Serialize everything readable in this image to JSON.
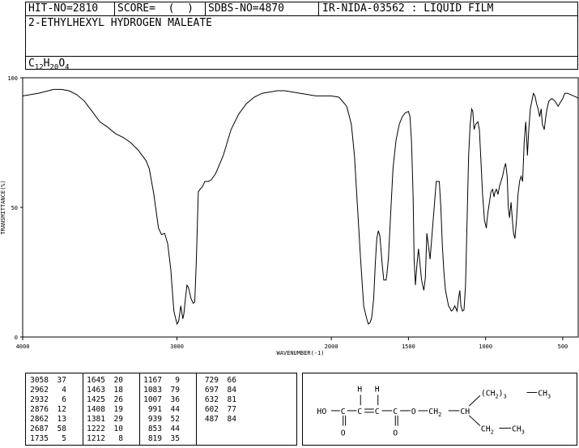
{
  "header": {
    "hit_no": "HIT-NO=2810",
    "score": "SCORE=  (  )",
    "sdbs_no": "SDBS-NO=4870",
    "method": "IR-NIDA-03562 : LIQUID FILM",
    "compound_name": "2-ETHYLHEXYL HYDROGEN MALEATE",
    "formula": {
      "c": "C",
      "c_n": "12",
      "h": "H",
      "h_n": "20",
      "o": "O",
      "o_n": "4"
    }
  },
  "chart_data": {
    "type": "line",
    "xlabel": "WAVENUMBER(-1)",
    "ylabel": "TRANSMITTANCE(%)",
    "xlim": [
      4000,
      400
    ],
    "ylim": [
      0,
      100
    ],
    "x_ticks": [
      4000,
      3000,
      2000,
      1500,
      1000,
      500
    ],
    "x_tick_labels": [
      "4000",
      "3000",
      "2000",
      "1500",
      "1000",
      "500"
    ],
    "y_ticks": [
      0,
      50,
      100
    ],
    "y_tick_labels": [
      "0",
      "50",
      "100"
    ],
    "series": [
      {
        "x": [
          4000,
          3900,
          3800,
          3750,
          3700,
          3650,
          3600,
          3550,
          3500,
          3450,
          3400,
          3350,
          3300,
          3250,
          3200,
          3180,
          3150,
          3120,
          3100,
          3080,
          3060,
          3040,
          3020,
          3000,
          2990,
          2975,
          2962,
          2955,
          2945,
          2935,
          2925,
          2910,
          2895,
          2885,
          2875,
          2862,
          2850,
          2835,
          2820,
          2800,
          2780,
          2750,
          2700,
          2650,
          2600,
          2550,
          2500,
          2450,
          2400,
          2350,
          2300,
          2250,
          2200,
          2150,
          2100,
          2050,
          2000,
          1950,
          1900,
          1870,
          1850,
          1830,
          1810,
          1790,
          1770,
          1760,
          1750,
          1740,
          1735,
          1725,
          1715,
          1705,
          1695,
          1685,
          1670,
          1660,
          1650,
          1645,
          1640,
          1630,
          1615,
          1600,
          1580,
          1560,
          1540,
          1520,
          1500,
          1490,
          1480,
          1470,
          1463,
          1455,
          1445,
          1435,
          1425,
          1415,
          1408,
          1400,
          1390,
          1381,
          1370,
          1360,
          1340,
          1320,
          1300,
          1290,
          1280,
          1270,
          1260,
          1250,
          1240,
          1230,
          1222,
          1212,
          1200,
          1185,
          1175,
          1167,
          1160,
          1150,
          1140,
          1130,
          1120,
          1110,
          1100,
          1090,
          1083,
          1075,
          1065,
          1050,
          1040,
          1030,
          1020,
          1007,
          995,
          991,
          985,
          975,
          965,
          955,
          945,
          939,
          930,
          920,
          910,
          900,
          890,
          880,
          870,
          860,
          853,
          845,
          835,
          825,
          819,
          810,
          800,
          790,
          780,
          770,
          760,
          750,
          740,
          735,
          729,
          720,
          710,
          697,
          690,
          680,
          670,
          660,
          650,
          640,
          632,
          620,
          610,
          602,
          590,
          570,
          550,
          530,
          500,
          487,
          470,
          450,
          430,
          410,
          400
        ],
        "y": [
          93,
          94,
          95.5,
          95.5,
          95,
          93.5,
          91,
          87,
          83,
          81,
          78.5,
          77,
          75,
          72,
          68,
          65,
          55,
          42,
          39.5,
          40,
          36,
          26,
          10,
          5,
          6,
          12,
          7,
          9,
          15,
          20,
          19,
          15,
          13,
          13.5,
          29,
          56,
          57,
          58,
          60,
          60,
          60.5,
          63,
          70,
          80,
          86,
          90,
          92.5,
          94,
          94.5,
          95,
          95,
          94.5,
          94,
          93.5,
          93,
          93,
          93,
          92.5,
          89,
          82,
          70,
          50,
          30,
          12,
          7,
          5,
          5.5,
          7,
          9,
          15,
          28,
          38,
          41,
          39,
          28,
          22,
          22,
          22,
          24,
          30,
          48,
          65,
          76,
          82,
          85,
          86.5,
          87,
          85,
          75,
          55,
          30,
          20,
          28,
          34,
          28,
          22,
          20,
          18,
          23,
          40,
          35,
          30,
          45,
          60,
          60,
          50,
          35,
          25,
          18,
          15,
          12,
          11,
          10,
          10.5,
          12,
          10,
          15,
          18,
          12,
          10,
          10.5,
          20,
          45,
          70,
          82,
          88,
          87,
          80,
          82,
          83,
          80,
          68,
          55,
          45,
          42,
          45,
          48,
          52,
          56,
          57,
          54,
          56,
          57,
          55,
          58,
          60,
          62,
          65,
          67,
          62,
          50,
          46,
          52,
          44,
          40,
          38,
          45,
          55,
          60,
          62,
          60,
          75,
          83,
          78,
          70,
          80,
          88,
          92,
          94,
          93,
          90,
          88,
          85,
          88,
          82,
          80,
          85,
          88,
          91,
          92,
          91,
          89,
          92,
          94,
          94,
          93.5,
          93,
          92.5,
          92
        ]
      }
    ],
    "peaks": [
      {
        "wn": 3058,
        "t": 37
      },
      {
        "wn": 2962,
        "t": 4
      },
      {
        "wn": 2932,
        "t": 6
      },
      {
        "wn": 2876,
        "t": 12
      },
      {
        "wn": 2862,
        "t": 13
      },
      {
        "wn": 2687,
        "t": 58
      },
      {
        "wn": 1735,
        "t": 5
      },
      {
        "wn": 1645,
        "t": 20
      },
      {
        "wn": 1463,
        "t": 18
      },
      {
        "wn": 1425,
        "t": 26
      },
      {
        "wn": 1408,
        "t": 19
      },
      {
        "wn": 1381,
        "t": 29
      },
      {
        "wn": 1222,
        "t": 10
      },
      {
        "wn": 1212,
        "t": 8
      },
      {
        "wn": 1167,
        "t": 9
      },
      {
        "wn": 1083,
        "t": 79
      },
      {
        "wn": 1007,
        "t": 36
      },
      {
        "wn": 991,
        "t": 44
      },
      {
        "wn": 939,
        "t": 52
      },
      {
        "wn": 853,
        "t": 44
      },
      {
        "wn": 819,
        "t": 35
      },
      {
        "wn": 729,
        "t": 66
      },
      {
        "wn": 697,
        "t": 84
      },
      {
        "wn": 632,
        "t": 81
      },
      {
        "wn": 602,
        "t": 77
      },
      {
        "wn": 487,
        "t": 84
      }
    ]
  },
  "structure": {
    "h1": "H",
    "h2": "H",
    "ho": "HO",
    "c1": "C",
    "c2": "C",
    "c3": "C",
    "c4": "C",
    "o_ester": "O",
    "ch2": "CH",
    "ch2_sub": "2",
    "ch": "CH",
    "o1": "O",
    "o2": "O",
    "top_chain_pre": "(CH",
    "top_chain_sub": "2",
    "top_chain_post": ")",
    "top_chain_n": "3",
    "top_ch3": "CH",
    "top_ch3_sub": "3",
    "bot_ch2": "CH",
    "bot_ch2_sub": "2",
    "bot_ch3": "CH",
    "bot_ch3_sub": "3"
  }
}
